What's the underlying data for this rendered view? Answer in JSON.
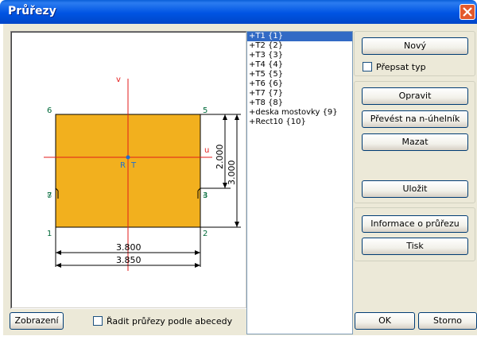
{
  "window": {
    "title": "Průřezy",
    "close_icon": "close-icon"
  },
  "drawing": {
    "axis_v_label": "v",
    "axis_u_label": "u",
    "centroid_label_r": "R",
    "centroid_label_t": "T",
    "vertex_labels": [
      "1",
      "2",
      "3",
      "4",
      "5",
      "6",
      "7",
      "8"
    ],
    "dim_width_1": "3.800",
    "dim_width_2": "3.850",
    "dim_height_1": "2.000",
    "dim_height_2": "3.000",
    "fill_color": "#f2b01e",
    "axis_color": "#e31b1b",
    "label_color": "#006a3a"
  },
  "sections": [
    "+T1 {1}",
    "+T2 {2}",
    "+T3 {3}",
    "+T4 {4}",
    "+T5 {5}",
    "+T6 {6}",
    "+T7 {7}",
    "+T8 {8}",
    "+deska mostovky {9}",
    "+Rect10 {10}"
  ],
  "buttons": {
    "new": "Nový",
    "overwrite_type": "Přepsat typ",
    "edit": "Opravit",
    "convert": "Převést na n-úhelník",
    "delete": "Mazat",
    "save": "Uložit",
    "info": "Informace o průřezu",
    "print": "Tisk",
    "display": "Zobrazení",
    "sort_alpha": "Řadit průřezy podle abecedy",
    "ok": "OK",
    "cancel": "Storno"
  }
}
